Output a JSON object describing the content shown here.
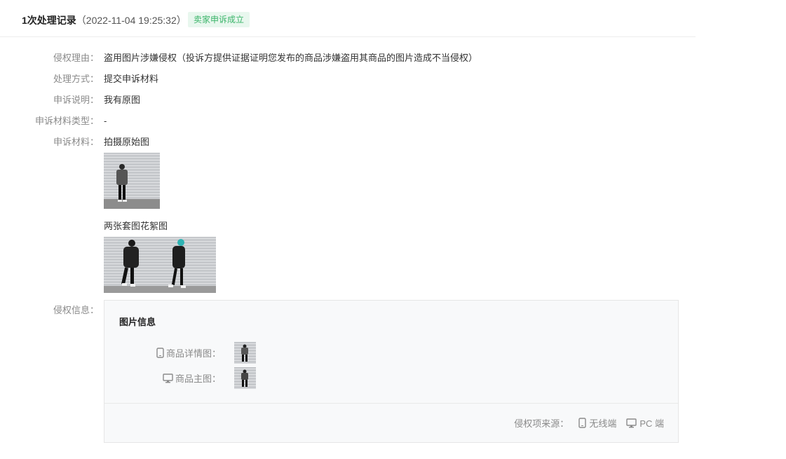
{
  "header": {
    "title_count": "1次处理记录",
    "timestamp": "（2022-11-04 19:25:32）",
    "status_badge": "卖家申诉成立"
  },
  "fields": {
    "reason": {
      "label": "侵权理由：",
      "value": "盗用图片涉嫌侵权（投诉方提供证据证明您发布的商品涉嫌盗用其商品的图片造成不当侵权）"
    },
    "method": {
      "label": "处理方式：",
      "value": "提交申诉材料"
    },
    "explanation": {
      "label": "申诉说明：",
      "value": "我有原图"
    },
    "material_type": {
      "label": "申诉材料类型：",
      "value": "-"
    },
    "materials": {
      "label": "申诉材料：",
      "groups": [
        {
          "caption": "拍摄原始图"
        },
        {
          "caption": "两张套图花絮图"
        }
      ]
    },
    "infringement": {
      "label": "侵权信息：",
      "panel_title": "图片信息",
      "rows": [
        {
          "label": "商品详情图：",
          "icon": "mobile-icon"
        },
        {
          "label": "商品主图：",
          "icon": "desktop-icon"
        }
      ],
      "source_label": "侵权项来源：",
      "sources": [
        {
          "label": "无线端",
          "icon": "mobile-icon"
        },
        {
          "label": "PC 端",
          "icon": "desktop-icon"
        }
      ]
    }
  },
  "colors": {
    "badge_text": "#3bb46a",
    "badge_bg": "#e8f7ee",
    "label": "#8a8a8a"
  }
}
